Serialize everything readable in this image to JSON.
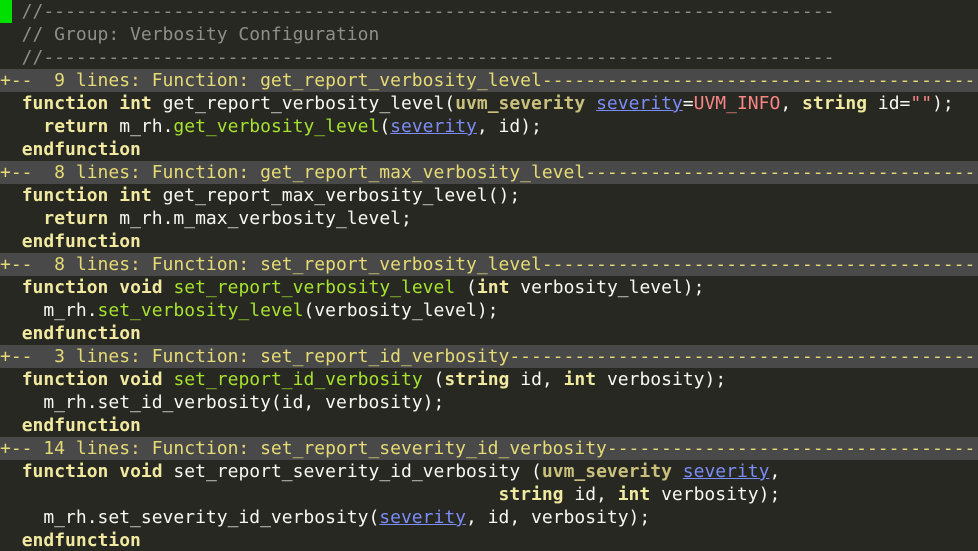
{
  "editor": {
    "lines": [
      {
        "kind": "comment",
        "cursor": true,
        "tokens": [
          {
            "t": "  //-------------------------------------------------------------------------",
            "c": "comment"
          }
        ]
      },
      {
        "kind": "comment",
        "tokens": [
          {
            "t": "  // Group: Verbosity Configuration",
            "c": "comment"
          }
        ]
      },
      {
        "kind": "comment",
        "tokens": [
          {
            "t": "  //-------------------------------------------------------------------------",
            "c": "comment"
          }
        ]
      },
      {
        "kind": "fold",
        "tokens": [
          {
            "t": "+--  9 lines: Function: get_report_verbosity_level---------------------------------------------",
            "c": "fold"
          }
        ]
      },
      {
        "kind": "code",
        "tokens": [
          {
            "t": "  ",
            "c": "plain"
          },
          {
            "t": "function",
            "c": "kw"
          },
          {
            "t": " ",
            "c": "plain"
          },
          {
            "t": "int",
            "c": "kw"
          },
          {
            "t": " get_report_verbosity_level(",
            "c": "plain"
          },
          {
            "t": "uvm_severity",
            "c": "type"
          },
          {
            "t": " ",
            "c": "plain"
          },
          {
            "t": "severity",
            "c": "param"
          },
          {
            "t": "=",
            "c": "plain"
          },
          {
            "t": "UVM_INFO",
            "c": "const"
          },
          {
            "t": ", ",
            "c": "plain"
          },
          {
            "t": "string",
            "c": "kw"
          },
          {
            "t": " id=",
            "c": "plain"
          },
          {
            "t": "\"\"",
            "c": "str"
          },
          {
            "t": ");",
            "c": "plain"
          }
        ]
      },
      {
        "kind": "code",
        "tokens": [
          {
            "t": "    ",
            "c": "plain"
          },
          {
            "t": "return",
            "c": "kw"
          },
          {
            "t": " m_rh.",
            "c": "plain"
          },
          {
            "t": "get_verbosity_level",
            "c": "fn"
          },
          {
            "t": "(",
            "c": "plain"
          },
          {
            "t": "severity",
            "c": "param"
          },
          {
            "t": ", id);",
            "c": "plain"
          }
        ]
      },
      {
        "kind": "code",
        "tokens": [
          {
            "t": "  ",
            "c": "plain"
          },
          {
            "t": "endfunction",
            "c": "kw"
          }
        ]
      },
      {
        "kind": "fold",
        "tokens": [
          {
            "t": "+--  8 lines: Function: get_report_max_verbosity_level-----------------------------------------",
            "c": "fold"
          }
        ]
      },
      {
        "kind": "code",
        "tokens": [
          {
            "t": "  ",
            "c": "plain"
          },
          {
            "t": "function",
            "c": "kw"
          },
          {
            "t": " ",
            "c": "plain"
          },
          {
            "t": "int",
            "c": "kw"
          },
          {
            "t": " get_report_max_verbosity_level();",
            "c": "plain"
          }
        ]
      },
      {
        "kind": "code",
        "tokens": [
          {
            "t": "    ",
            "c": "plain"
          },
          {
            "t": "return",
            "c": "kw"
          },
          {
            "t": " m_rh.m_max_verbosity_level;",
            "c": "plain"
          }
        ]
      },
      {
        "kind": "code",
        "tokens": [
          {
            "t": "  ",
            "c": "plain"
          },
          {
            "t": "endfunction",
            "c": "kw"
          }
        ]
      },
      {
        "kind": "fold",
        "tokens": [
          {
            "t": "+--  8 lines: Function: set_report_verbosity_level---------------------------------------------",
            "c": "fold"
          }
        ]
      },
      {
        "kind": "code",
        "tokens": [
          {
            "t": "  ",
            "c": "plain"
          },
          {
            "t": "function",
            "c": "kw"
          },
          {
            "t": " ",
            "c": "plain"
          },
          {
            "t": "void",
            "c": "kw"
          },
          {
            "t": " ",
            "c": "plain"
          },
          {
            "t": "set_report_verbosity_level",
            "c": "fn"
          },
          {
            "t": " (",
            "c": "plain"
          },
          {
            "t": "int",
            "c": "kw"
          },
          {
            "t": " verbosity_level);",
            "c": "plain"
          }
        ]
      },
      {
        "kind": "code",
        "tokens": [
          {
            "t": "    m_rh.",
            "c": "plain"
          },
          {
            "t": "set_verbosity_level",
            "c": "fn"
          },
          {
            "t": "(verbosity_level);",
            "c": "plain"
          }
        ]
      },
      {
        "kind": "code",
        "tokens": [
          {
            "t": "  ",
            "c": "plain"
          },
          {
            "t": "endfunction",
            "c": "kw"
          }
        ]
      },
      {
        "kind": "fold",
        "tokens": [
          {
            "t": "+--  3 lines: Function: set_report_id_verbosity------------------------------------------------",
            "c": "fold"
          }
        ]
      },
      {
        "kind": "code",
        "tokens": [
          {
            "t": "  ",
            "c": "plain"
          },
          {
            "t": "function",
            "c": "kw"
          },
          {
            "t": " ",
            "c": "plain"
          },
          {
            "t": "void",
            "c": "kw"
          },
          {
            "t": " ",
            "c": "plain"
          },
          {
            "t": "set_report_id_verbosity",
            "c": "fn"
          },
          {
            "t": " (",
            "c": "plain"
          },
          {
            "t": "string",
            "c": "kw"
          },
          {
            "t": " id, ",
            "c": "plain"
          },
          {
            "t": "int",
            "c": "kw"
          },
          {
            "t": " verbosity);",
            "c": "plain"
          }
        ]
      },
      {
        "kind": "code",
        "tokens": [
          {
            "t": "    m_rh.set_id_verbosity(id, verbosity);",
            "c": "plain"
          }
        ]
      },
      {
        "kind": "code",
        "tokens": [
          {
            "t": "  ",
            "c": "plain"
          },
          {
            "t": "endfunction",
            "c": "kw"
          }
        ]
      },
      {
        "kind": "fold",
        "tokens": [
          {
            "t": "+-- 14 lines: Function: set_report_severity_id_verbosity---------------------------------------",
            "c": "fold"
          }
        ]
      },
      {
        "kind": "code",
        "tokens": [
          {
            "t": "  ",
            "c": "plain"
          },
          {
            "t": "function",
            "c": "kw"
          },
          {
            "t": " ",
            "c": "plain"
          },
          {
            "t": "void",
            "c": "kw"
          },
          {
            "t": " set_report_severity_id_verbosity (",
            "c": "plain"
          },
          {
            "t": "uvm_severity",
            "c": "type"
          },
          {
            "t": " ",
            "c": "plain"
          },
          {
            "t": "severity",
            "c": "param"
          },
          {
            "t": ",",
            "c": "plain"
          }
        ]
      },
      {
        "kind": "code",
        "tokens": [
          {
            "t": "                                              ",
            "c": "plain"
          },
          {
            "t": "string",
            "c": "kw"
          },
          {
            "t": " id, ",
            "c": "plain"
          },
          {
            "t": "int",
            "c": "kw"
          },
          {
            "t": " verbosity);",
            "c": "plain"
          }
        ]
      },
      {
        "kind": "code",
        "tokens": [
          {
            "t": "    m_rh.set_severity_id_verbosity(",
            "c": "plain"
          },
          {
            "t": "severity",
            "c": "param"
          },
          {
            "t": ", id, verbosity);",
            "c": "plain"
          }
        ]
      },
      {
        "kind": "code",
        "tokens": [
          {
            "t": "  ",
            "c": "plain"
          },
          {
            "t": "endfunction",
            "c": "kw"
          }
        ]
      }
    ]
  }
}
